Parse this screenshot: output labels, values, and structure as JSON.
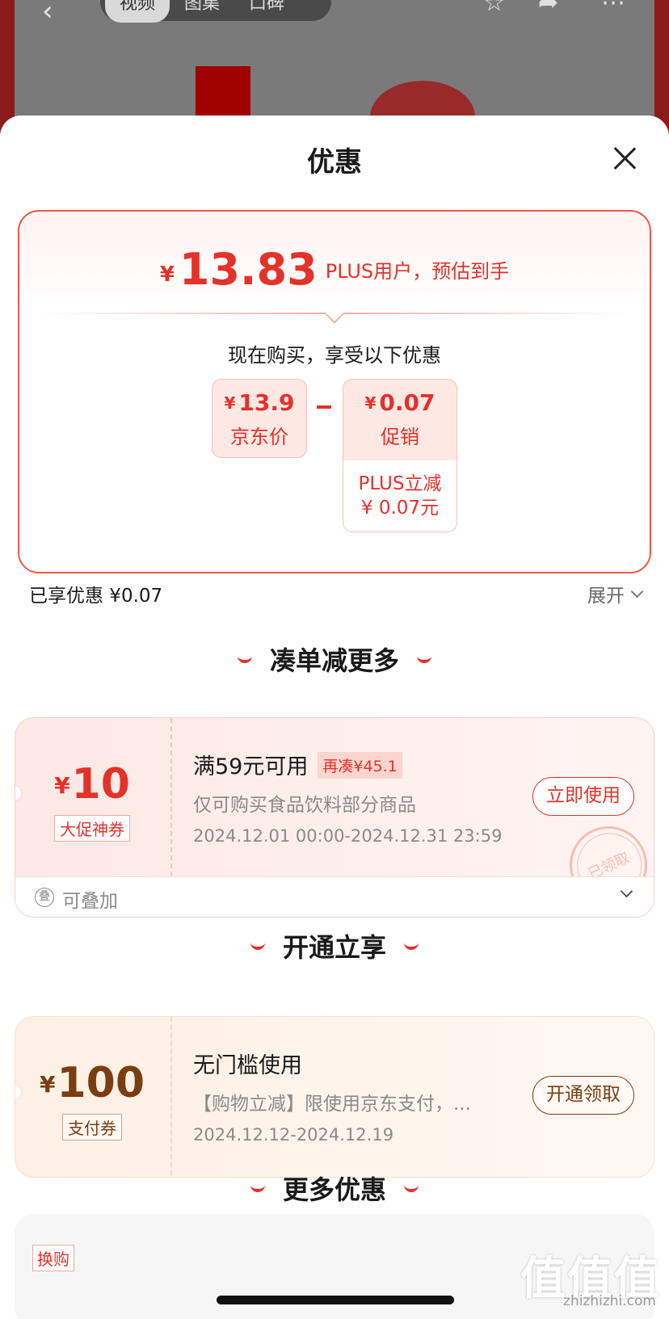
{
  "background": {
    "tabs": [
      "视频",
      "图集",
      "口碑"
    ]
  },
  "sheet": {
    "title": "优惠"
  },
  "price_card": {
    "currency": "¥",
    "price": "13.83",
    "note": "PLUS用户，预估到手",
    "buy_caption": "现在购买，享受以下优惠",
    "jd_price": {
      "value": "13.9",
      "label": "京东价"
    },
    "promo": {
      "value": "0.07",
      "label": "促销",
      "detail_title": "PLUS立减",
      "detail_value": "¥ 0.07元"
    }
  },
  "enjoyed": {
    "text": "已享优惠 ¥0.07",
    "expand_label": "展开"
  },
  "sections": {
    "more_deals": "凑单减更多",
    "membership": "开通立享",
    "more_offers": "更多优惠"
  },
  "coupon1": {
    "currency": "¥",
    "amount": "10",
    "tag": "大促神券",
    "condition": "满59元可用",
    "need_more": "再凑¥45.1",
    "description": "仅可购买食品饮料部分商品",
    "date_range": "2024.12.01 00:00-2024.12.31 23:59",
    "button": "立即使用",
    "stamp": "已领取",
    "stack_label": "可叠加",
    "stack_icon_glyph": "叠"
  },
  "coupon2": {
    "currency": "¥",
    "amount": "100",
    "tag": "支付券",
    "condition": "无门槛使用",
    "description": "【购物立减】限使用京东支付，...",
    "date_range": "2024.12.12-2024.12.19",
    "button": "开通领取"
  },
  "more_card": {
    "tag": "换购"
  },
  "watermark": {
    "logo_text": "值值值",
    "url": "zhizhizhi.com"
  },
  "colors": {
    "accent_red": "#e4322a",
    "coupon_brown": "#7a3d12"
  }
}
